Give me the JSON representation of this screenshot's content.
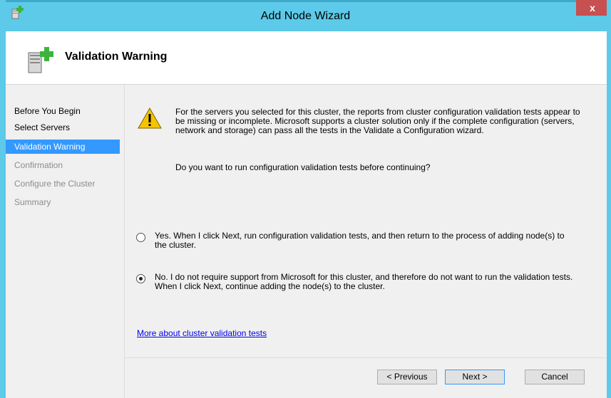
{
  "window": {
    "title": "Add Node Wizard",
    "close_glyph": "x"
  },
  "header": {
    "title": "Validation Warning",
    "icon": "server-add-icon"
  },
  "sidebar": {
    "items": [
      {
        "label": "Before You Begin",
        "state": "done"
      },
      {
        "label": "Select Servers",
        "state": "done"
      },
      {
        "label": "Validation Warning",
        "state": "active"
      },
      {
        "label": "Confirmation",
        "state": "pending"
      },
      {
        "label": "Configure the Cluster",
        "state": "pending"
      },
      {
        "label": "Summary",
        "state": "pending"
      }
    ]
  },
  "main": {
    "warning_text": "For the servers you selected for this cluster, the reports from cluster configuration validation tests appear to be missing or incomplete.  Microsoft supports a cluster solution only if the complete configuration (servers, network and storage) can pass all the tests in the Validate a Configuration wizard.",
    "question": "Do you want to run configuration validation tests before continuing?",
    "options": [
      {
        "label": "Yes.  When I click Next, run configuration validation tests, and then return to the process of adding node(s) to the cluster.",
        "selected": false
      },
      {
        "label": "No.  I do not require support from Microsoft for this cluster, and therefore do not want to run the validation tests.  When I click Next, continue adding the node(s) to the cluster.",
        "selected": true
      }
    ],
    "more_link": "More about cluster validation tests"
  },
  "footer": {
    "previous_label": "< Previous",
    "next_label": "Next >",
    "cancel_label": "Cancel"
  },
  "colors": {
    "titlebar": "#5ccae8",
    "active_nav": "#3399ff",
    "close_button": "#c75050"
  }
}
